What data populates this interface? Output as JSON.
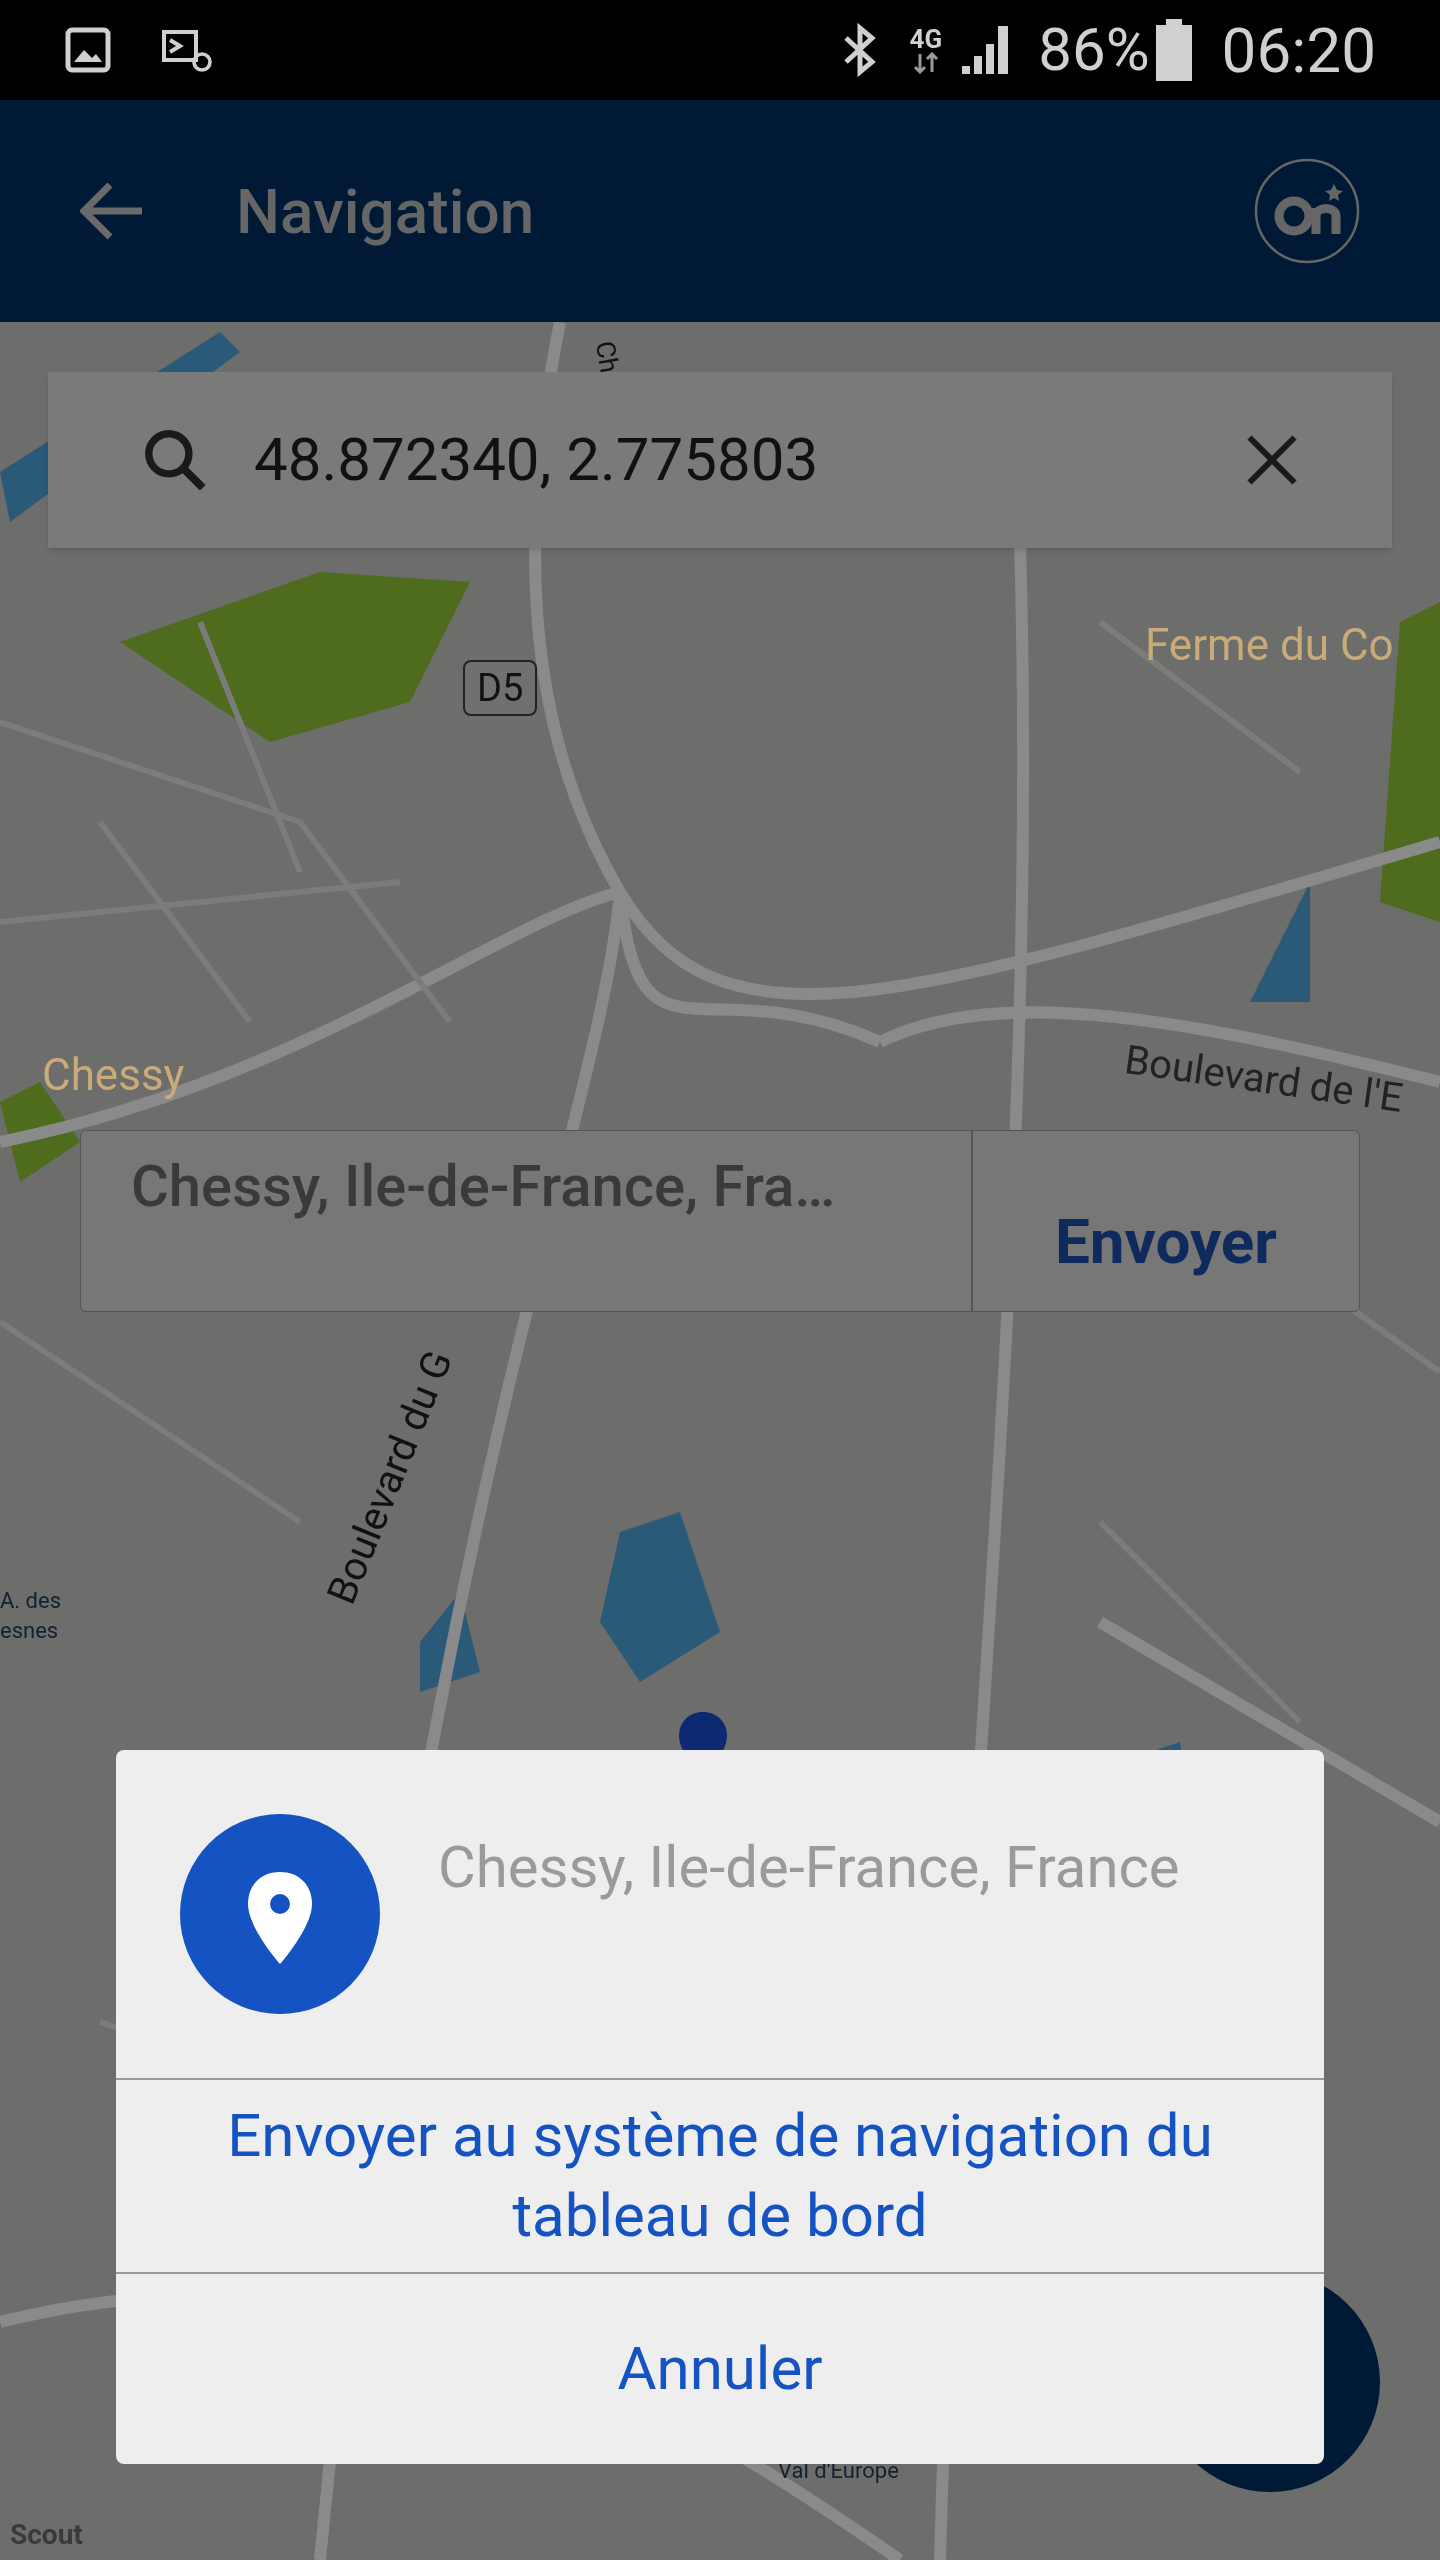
{
  "status_bar": {
    "network": "4G",
    "battery": "86%",
    "time": "06:20"
  },
  "header": {
    "title": "Navigation"
  },
  "search": {
    "value": "48.872340, 2.775803"
  },
  "map": {
    "labels": [
      {
        "kind": "street",
        "text": "Ch"
      },
      {
        "kind": "place",
        "text": "Ferme du Co"
      },
      {
        "kind": "shield",
        "text": "D5"
      },
      {
        "kind": "place",
        "text": "Chessy"
      },
      {
        "kind": "street",
        "text": "Boulevard de l'E"
      },
      {
        "kind": "street",
        "text": "Boulevard du G"
      },
      {
        "kind": "street",
        "text": "A. des"
      },
      {
        "kind": "street",
        "text": "esnes"
      },
      {
        "kind": "street",
        "text": "Val d'Europe"
      },
      {
        "kind": "logo",
        "text": "Scout"
      }
    ]
  },
  "callout": {
    "address": "Chessy, Ile-de-France, Fra…",
    "button": "Envoyer"
  },
  "dialog": {
    "address": "Chessy, Ile-de-France, France",
    "actions": [
      "Envoyer au système de navigation du tableau de bord",
      "Annuler"
    ]
  }
}
